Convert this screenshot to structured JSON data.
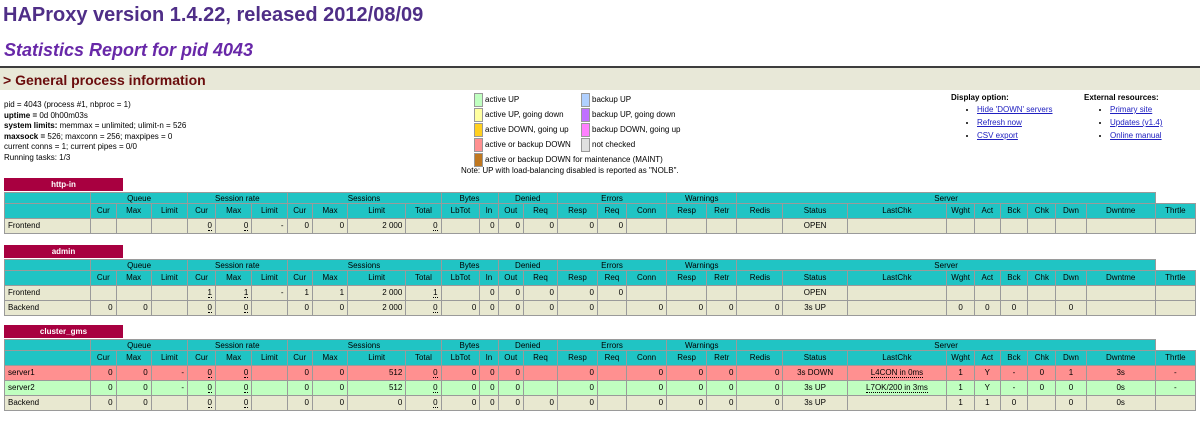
{
  "title": "HAProxy version 1.4.22, released 2012/08/09",
  "subtitle": "Statistics Report for pid 4043",
  "section_title": "> General process information",
  "process_info": [
    {
      "label": "pid = ",
      "bold": false,
      "value": "4043 (process #1, nbproc = 1)"
    },
    {
      "label": "uptime = ",
      "bold": true,
      "value": "0d 0h00m03s"
    },
    {
      "label": "system limits: ",
      "bold": true,
      "value": "memmax = unlimited; ulimit-n = 526"
    },
    {
      "label": "maxsock = ",
      "bold": true,
      "value": "526; maxconn = 256; maxpipes = 0"
    },
    {
      "label": "",
      "bold": false,
      "value": "current conns = 1; current pipes = 0/0"
    },
    {
      "label": "",
      "bold": false,
      "value": "Running tasks: 1/3"
    }
  ],
  "legend": {
    "items": [
      {
        "label": "active UP",
        "color": "#c0ffc0"
      },
      {
        "label": "backup UP",
        "color": "#b0d0ff"
      },
      {
        "label": "active UP, going down",
        "color": "#ffffa0"
      },
      {
        "label": "backup UP, going down",
        "color": "#c070ff"
      },
      {
        "label": "active DOWN, going up",
        "color": "#ffd020"
      },
      {
        "label": "backup DOWN, going up",
        "color": "#ff80ff"
      },
      {
        "label": "active or backup DOWN",
        "color": "#ff9090"
      },
      {
        "label": "not checked",
        "color": "#e0e0e0"
      },
      {
        "label": "active or backup DOWN for maintenance (MAINT)",
        "color": "#c07820"
      }
    ],
    "note": "Note: UP with load-balancing disabled is reported as \"NOLB\"."
  },
  "display_options": {
    "title": "Display option:",
    "links": [
      "Hide 'DOWN' servers",
      "Refresh now",
      "CSV export"
    ]
  },
  "external_resources": {
    "title": "External resources:",
    "links": [
      "Primary site",
      "Updates (v1.4)",
      "Online manual"
    ]
  },
  "proxies": [
    {
      "name": "http-in",
      "rows": [
        {
          "type": "fe",
          "cells": [
            "Frontend",
            "",
            "",
            "",
            "0",
            "0",
            "-",
            "0",
            "0",
            "2 000",
            "0",
            "",
            "0",
            "0",
            "0",
            "0",
            "0",
            "",
            "",
            "",
            "",
            "OPEN",
            "",
            "",
            "",
            "",
            "",
            "",
            "",
            ""
          ]
        }
      ]
    },
    {
      "name": "admin",
      "rows": [
        {
          "type": "fe",
          "cells": [
            "Frontend",
            "",
            "",
            "",
            "1",
            "1",
            "-",
            "1",
            "1",
            "2 000",
            "1",
            "",
            "0",
            "0",
            "0",
            "0",
            "0",
            "",
            "",
            "",
            "",
            "OPEN",
            "",
            "",
            "",
            "",
            "",
            "",
            "",
            ""
          ]
        },
        {
          "type": "be",
          "cells": [
            "Backend",
            "0",
            "0",
            "",
            "0",
            "0",
            "",
            "0",
            "0",
            "2 000",
            "0",
            "0",
            "0",
            "0",
            "0",
            "0",
            "",
            "0",
            "0",
            "0",
            "0",
            "3s UP",
            "",
            "0",
            "0",
            "0",
            "",
            "0",
            "",
            ""
          ]
        }
      ]
    },
    {
      "name": "cluster_gms",
      "rows": [
        {
          "type": "down",
          "cells": [
            "server1",
            "0",
            "0",
            "-",
            "0",
            "0",
            "",
            "0",
            "0",
            "512",
            "0",
            "0",
            "0",
            "0",
            "",
            "0",
            "",
            "0",
            "0",
            "0",
            "0",
            "3s DOWN",
            "L4CON in 0ms",
            "1",
            "Y",
            "-",
            "0",
            "1",
            "3s",
            "-"
          ]
        },
        {
          "type": "up",
          "cells": [
            "server2",
            "0",
            "0",
            "-",
            "0",
            "0",
            "",
            "0",
            "0",
            "512",
            "0",
            "0",
            "0",
            "0",
            "",
            "0",
            "",
            "0",
            "0",
            "0",
            "0",
            "3s UP",
            "L7OK/200 in 3ms",
            "1",
            "Y",
            "-",
            "0",
            "0",
            "0s",
            "-"
          ]
        },
        {
          "type": "be",
          "cells": [
            "Backend",
            "0",
            "0",
            "",
            "0",
            "0",
            "",
            "0",
            "0",
            "0",
            "0",
            "0",
            "0",
            "0",
            "0",
            "0",
            "",
            "0",
            "0",
            "0",
            "0",
            "3s UP",
            "",
            "1",
            "1",
            "0",
            "",
            "0",
            "0s",
            ""
          ]
        }
      ]
    }
  ],
  "groups": [
    "Queue",
    "Session rate",
    "Sessions",
    "Bytes",
    "Denied",
    "Errors",
    "Warnings",
    "Server"
  ],
  "columns": [
    "Cur",
    "Max",
    "Limit",
    "Cur",
    "Max",
    "Limit",
    "Cur",
    "Max",
    "Limit",
    "Total",
    "LbTot",
    "In",
    "Out",
    "Req",
    "Resp",
    "Req",
    "Conn",
    "Resp",
    "Retr",
    "Redis",
    "Status",
    "LastChk",
    "Wght",
    "Act",
    "Bck",
    "Chk",
    "Dwn",
    "Dwntme",
    "Thrtle"
  ]
}
